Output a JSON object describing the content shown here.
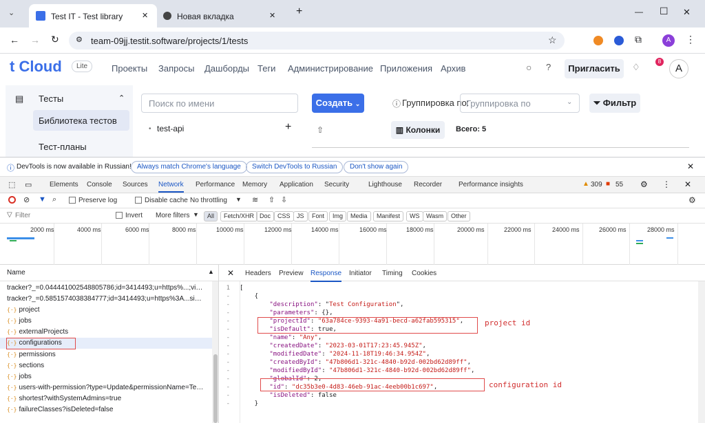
{
  "browser": {
    "tabs": [
      {
        "title": "Test IT - Test library",
        "close": "✕"
      },
      {
        "title": "Новая вкладка",
        "close": "✕"
      }
    ],
    "new_tab": "+",
    "url": "team-09jj.testit.software/projects/1/tests",
    "window_controls": {
      "minimize": "—",
      "maximize": "☐",
      "close": "✕"
    },
    "profile": "A"
  },
  "app": {
    "logo": "t Cloud",
    "plan": "Lite",
    "nav": [
      "Проекты",
      "Запросы",
      "Дашборды",
      "Теги",
      "Администрирование",
      "Приложения",
      "Архив"
    ],
    "invite": "Пригласить",
    "avatar": "A",
    "notif_badge": "8",
    "sidebar": {
      "section": "Тесты",
      "items": [
        "Библиотека тестов",
        "Тест-планы"
      ]
    },
    "search_placeholder": "Поиск по имени",
    "tree_item": "test-api",
    "create": "Создать",
    "grouping_label": "Группировка по:",
    "grouping_placeholder": "Группировка по",
    "filter": "Фильтр",
    "columns": "Колонки",
    "total": "Всего: 5"
  },
  "devtools": {
    "infobar": {
      "message": "DevTools is now available in Russian!",
      "buttons": [
        "Always match Chrome's language",
        "Switch DevTools to Russian",
        "Don't show again"
      ]
    },
    "tabs": [
      "Elements",
      "Console",
      "Sources",
      "Network",
      "Performance",
      "Memory",
      "Application",
      "Security",
      "Lighthouse",
      "Recorder",
      "Performance insights"
    ],
    "active_tab": "Network",
    "warnings": "309",
    "errors": "55",
    "toolbar": {
      "preserve_log": "Preserve log",
      "disable_cache": "Disable cache",
      "throttling": "No throttling"
    },
    "filter": {
      "placeholder": "Filter",
      "invert": "Invert",
      "more_filters": "More filters",
      "types": [
        "All",
        "Fetch/XHR",
        "Doc",
        "CSS",
        "JS",
        "Font",
        "Img",
        "Media",
        "Manifest",
        "WS",
        "Wasm",
        "Other"
      ]
    },
    "timeline_ticks": [
      "2000 ms",
      "4000 ms",
      "6000 ms",
      "8000 ms",
      "10000 ms",
      "12000 ms",
      "14000 ms",
      "16000 ms",
      "18000 ms",
      "20000 ms",
      "22000 ms",
      "24000 ms",
      "26000 ms",
      "28000 ms"
    ],
    "request_list": {
      "header": "Name",
      "items": [
        {
          "name": "tracker?_=0.044441002548805786;id=3414493;u=https%...;visible...",
          "xhr": false
        },
        {
          "name": "tracker?_=0.5851574038384777;id=3414493;u=https%3A...sible=t...",
          "xhr": false
        },
        {
          "name": "project",
          "xhr": true
        },
        {
          "name": "jobs",
          "xhr": true
        },
        {
          "name": "externalProjects",
          "xhr": true
        },
        {
          "name": "configurations",
          "xhr": true
        },
        {
          "name": "permissions",
          "xhr": true
        },
        {
          "name": "sections",
          "xhr": true
        },
        {
          "name": "jobs",
          "xhr": true
        },
        {
          "name": "users-with-permission?type=Update&permissionName=TestResu...",
          "xhr": true
        },
        {
          "name": "shortest?withSystemAdmins=true",
          "xhr": true
        },
        {
          "name": "failureClasses?isDeleted=false",
          "xhr": true
        }
      ]
    },
    "detail_tabs": [
      "Headers",
      "Preview",
      "Response",
      "Initiator",
      "Timing",
      "Cookies"
    ],
    "active_detail_tab": "Response",
    "response": {
      "description": "Test Configuration",
      "parameters": "{}",
      "projectId": "63a784ce-9393-4a91-becd-a62fab595315",
      "isDefault": "true",
      "name": "Any",
      "createdDate": "2023-03-01T17:23:45.945Z",
      "modifiedDate": "2024-11-18T19:46:34.954Z",
      "createdById": "47b806d1-321c-4840-b92d-002bd62d89ff",
      "modifiedById": "47b806d1-321c-4840-b92d-002bd62d89ff",
      "globalId": "2",
      "id": "dc35b3e0-4d83-46eb-91ac-4eeb00b1c697",
      "isDeleted": "false"
    },
    "annotations": {
      "project": "project id",
      "config": "configuration id"
    }
  }
}
